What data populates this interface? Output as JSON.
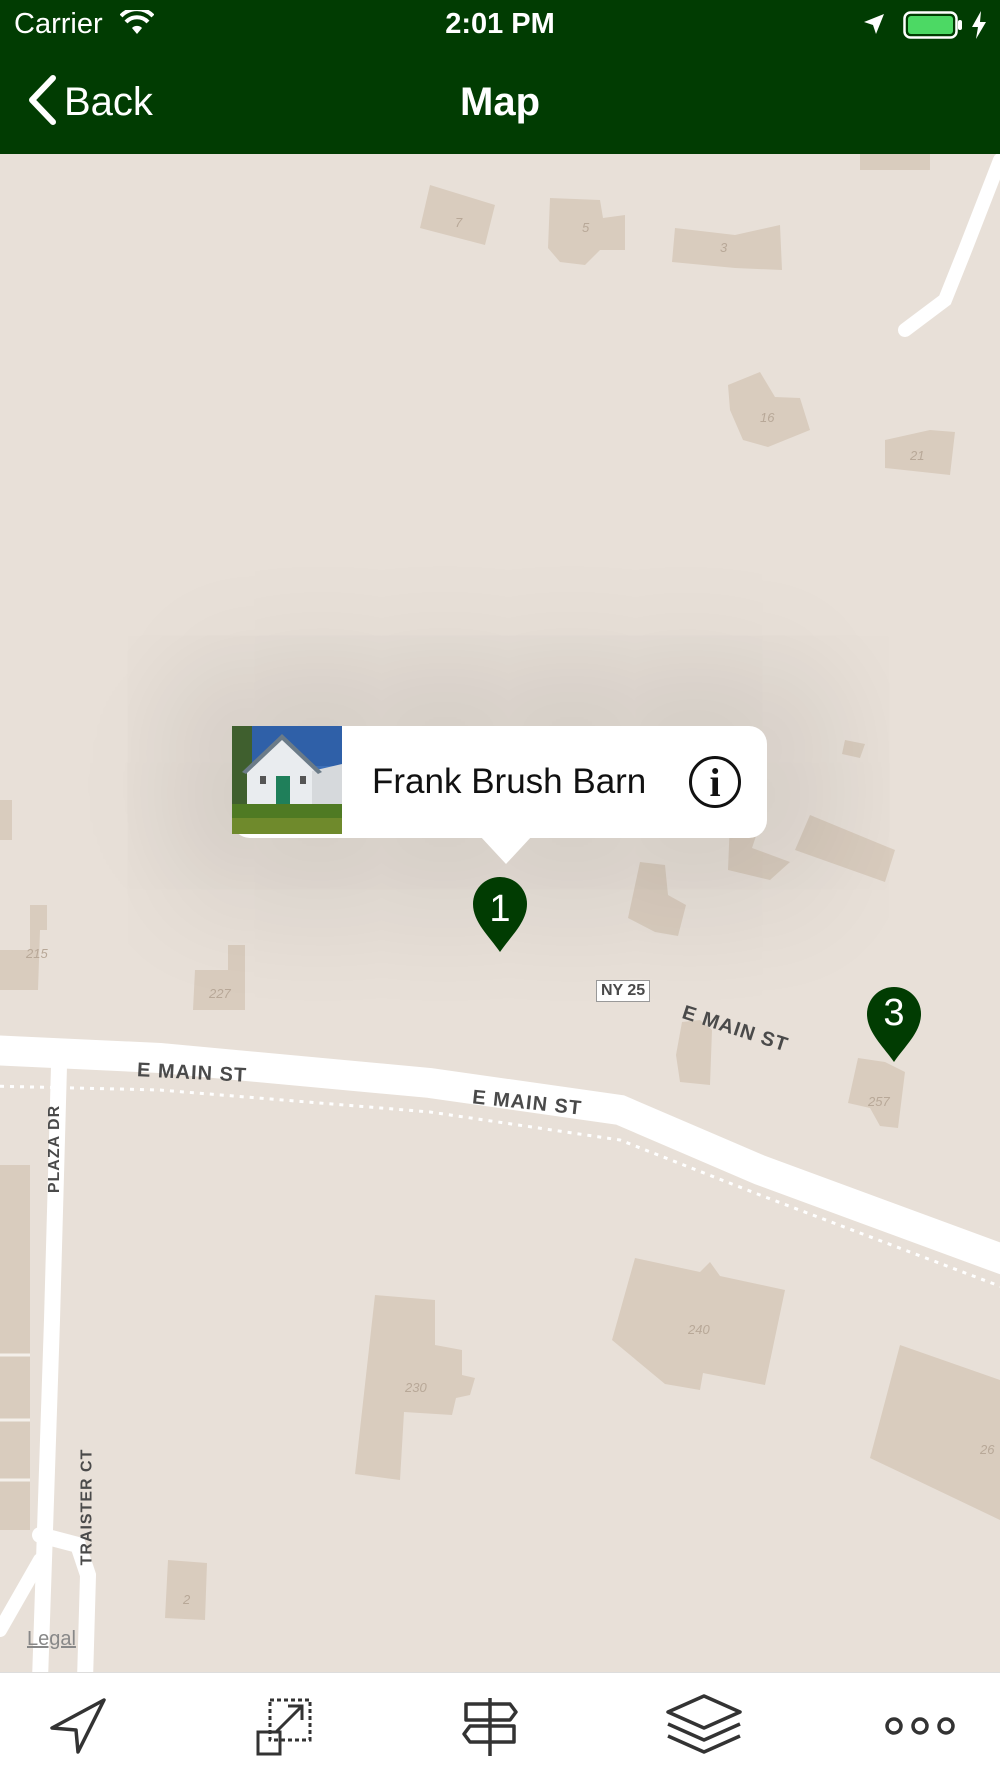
{
  "status_bar": {
    "carrier": "Carrier",
    "time": "2:01 PM"
  },
  "nav": {
    "back_label": "Back",
    "title": "Map"
  },
  "callout": {
    "title": "Frank Brush Barn",
    "info_icon": "info-circle-icon"
  },
  "pins": [
    {
      "number": "1"
    },
    {
      "number": "3"
    }
  ],
  "map": {
    "roads": {
      "e_main_1": "E MAIN ST",
      "e_main_2": "E MAIN ST",
      "e_main_3": "E MAIN ST",
      "ny25": "NY 25",
      "plaza": "PLAZA DR",
      "traister": "TRAISTER CT"
    },
    "legal": "Legal",
    "building_numbers": [
      "7",
      "5",
      "3",
      "16",
      "21",
      "215",
      "227",
      "257",
      "240",
      "230",
      "26",
      "2"
    ]
  },
  "toolbar": {
    "icons": [
      "location-arrow-icon",
      "expand-icon",
      "signpost-icon",
      "layers-icon",
      "more-icon"
    ]
  },
  "colors": {
    "brand": "#013c02",
    "map_bg": "#e8e0d8",
    "building": "#d9ccbe"
  }
}
